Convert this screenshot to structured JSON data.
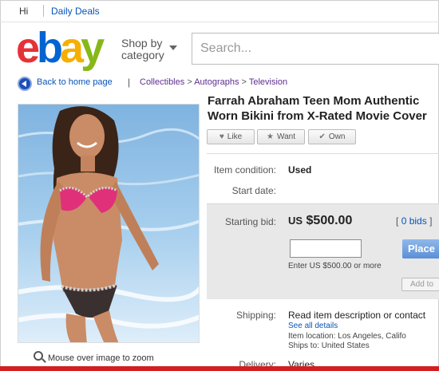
{
  "topbar": {
    "greeting": "Hi",
    "daily_deals": "Daily Deals"
  },
  "header": {
    "logo": {
      "e": "e",
      "b": "b",
      "a": "a",
      "y": "y",
      "colors": [
        "#e53238",
        "#0064d2",
        "#f5af02",
        "#86b817"
      ]
    },
    "shop_by_line1": "Shop by",
    "shop_by_line2": "category",
    "search_placeholder": "Search..."
  },
  "breadcrumb": {
    "back_label": "Back to home page",
    "separator": "|",
    "items": [
      "Collectibles",
      "Autographs",
      "Television"
    ],
    "arrow": ">"
  },
  "item": {
    "title": "Farrah Abraham Teen Mom Authentic Worn Bikini from X-Rated Movie Cover",
    "actions": [
      {
        "label": "Like",
        "icon": "heart-icon",
        "glyph": "♥"
      },
      {
        "label": "Want",
        "icon": "star-icon",
        "glyph": "★"
      },
      {
        "label": "Own",
        "icon": "check-icon",
        "glyph": "✔"
      }
    ],
    "condition_label": "Item condition:",
    "condition_value": "Used",
    "start_date_label": "Start date:",
    "start_date_value": ""
  },
  "bid": {
    "starting_bid_label": "Starting bid:",
    "currency": "US",
    "amount": "$500.00",
    "bids_open": "[",
    "bids_count": "0 bids",
    "bids_close": "]",
    "place_button": "Place",
    "enter_hint": "Enter US $500.00 or more",
    "add_button": "Add to"
  },
  "shipping": {
    "label": "Shipping:",
    "value": "Read item description or contact",
    "see_all": "See all details",
    "location": "Item location: Los Angeles, Califo",
    "ships_to": "Ships to: United States",
    "delivery_label": "Delivery:",
    "delivery_value": "Varies"
  },
  "photo": {
    "zoom_hint": "Mouse over image to zoom"
  },
  "colors": {
    "link": "#0654ba",
    "breadcrumb": "#5e2d91",
    "accent_red": "#d21f1f"
  }
}
